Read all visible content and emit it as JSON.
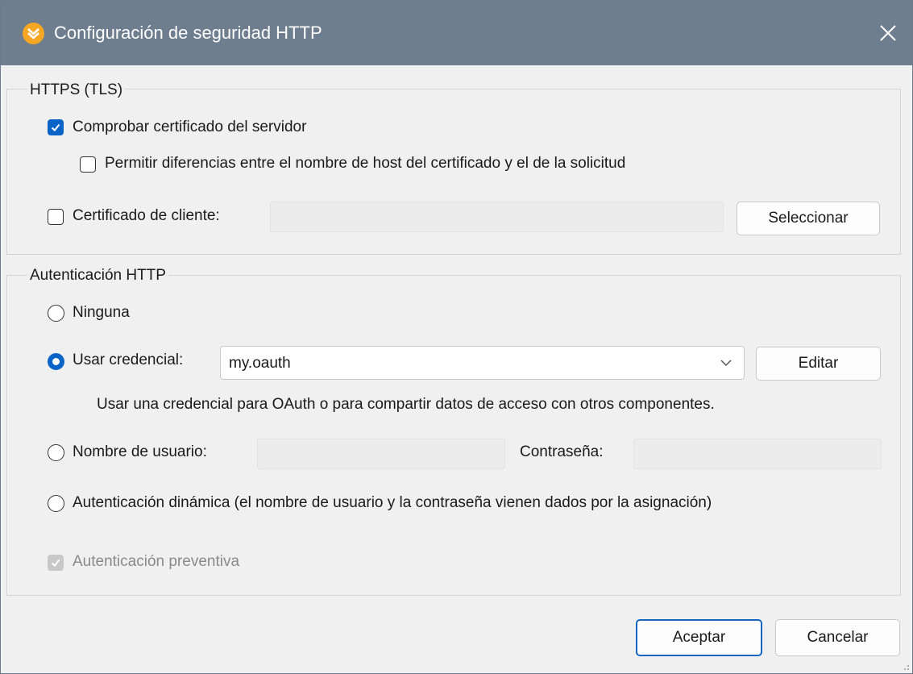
{
  "window": {
    "title": "Configuración de seguridad HTTP",
    "app_icon": "altova-mapforce-icon",
    "close_icon": "close-icon"
  },
  "https": {
    "legend": "HTTPS (TLS)",
    "verify_cert": {
      "label": "Comprobar certificado del servidor",
      "checked": true
    },
    "allow_mismatch": {
      "label": "Permitir diferencias entre el nombre de host del certificado y el de la solicitud",
      "checked": false
    },
    "client_cert": {
      "label": "Certificado de cliente:",
      "checked": false,
      "value": ""
    },
    "select_button": "Seleccionar"
  },
  "auth": {
    "legend": "Autenticación HTTP",
    "none": {
      "label": "Ninguna",
      "selected": false
    },
    "credential": {
      "label": "Usar credencial:",
      "selected": true,
      "value": "my.oauth",
      "edit_button": "Editar",
      "hint": "Usar una credencial para OAuth o para compartir datos de acceso con otros componentes."
    },
    "userpass": {
      "label": "Nombre de usuario:",
      "selected": false,
      "username": "",
      "password_label": "Contraseña:",
      "password": ""
    },
    "dynamic": {
      "label": "Autenticación dinámica (el nombre de usuario y la contraseña vienen dados por la asignación)",
      "selected": false
    },
    "preemptive": {
      "label": "Autenticación preventiva",
      "checked": true,
      "disabled": true
    }
  },
  "footer": {
    "ok": "Aceptar",
    "cancel": "Cancelar"
  },
  "colors": {
    "titlebar": "#6e7e8f",
    "accent": "#0a64c8",
    "app_icon": "#f5a623"
  }
}
